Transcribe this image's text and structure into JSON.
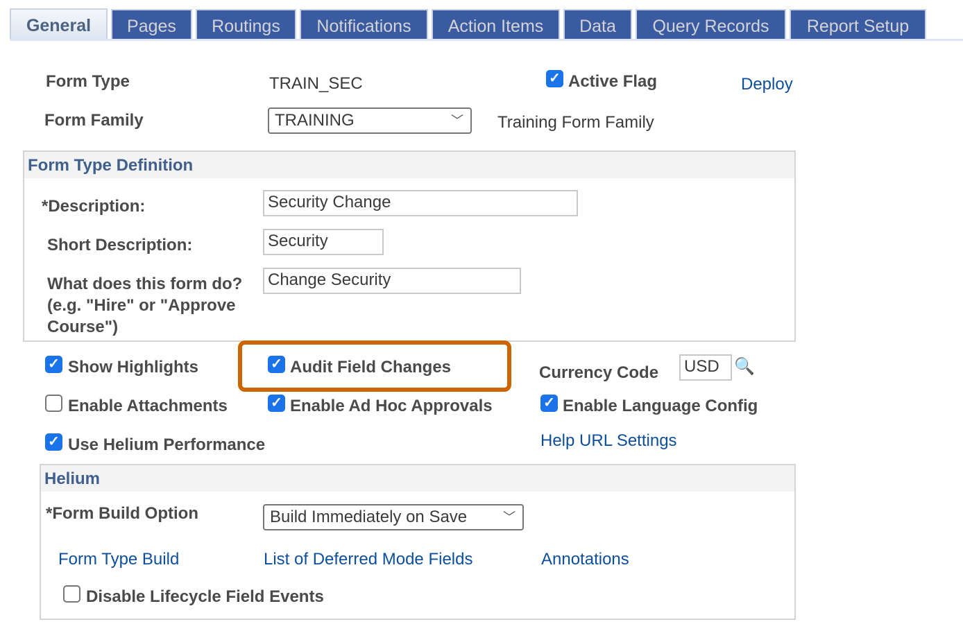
{
  "tabs": [
    {
      "label": "General",
      "active": true
    },
    {
      "label": "Pages"
    },
    {
      "label": "Routings"
    },
    {
      "label": "Notifications"
    },
    {
      "label": "Action Items"
    },
    {
      "label": "Data"
    },
    {
      "label": "Query Records"
    },
    {
      "label": "Report Setup"
    }
  ],
  "header": {
    "form_type_label": "Form Type",
    "form_type_value": "TRAIN_SEC",
    "active_flag_label": "Active Flag",
    "active_flag_checked": true,
    "deploy_link": "Deploy",
    "form_family_label": "Form Family",
    "form_family_value": "TRAINING",
    "form_family_desc": "Training Form Family"
  },
  "definition": {
    "title": "Form Type Definition",
    "description_label": "*Description:",
    "description_value": "Security Change",
    "short_label": "Short Description:",
    "short_value": "Security",
    "what_label_1": "What does this form do?",
    "what_label_2": "(e.g. \"Hire\" or \"Approve",
    "what_label_3": "Course\")",
    "what_value": "Change Security"
  },
  "options": {
    "show_highlights": "Show Highlights",
    "audit_field_changes": "Audit Field Changes",
    "currency_label": "Currency Code",
    "currency_value": "USD",
    "enable_attachments": "Enable Attachments",
    "enable_adhoc": "Enable Ad Hoc Approvals",
    "enable_language": "Enable Language Config",
    "use_helium": "Use Helium Performance",
    "help_url": "Help URL Settings"
  },
  "helium": {
    "title": "Helium",
    "build_label": "*Form Build Option",
    "build_value": "Build Immediately on Save",
    "form_type_build": "Form Type Build",
    "deferred_fields": "List of Deferred Mode Fields",
    "annotations": "Annotations",
    "disable_lifecycle": "Disable Lifecycle Field Events"
  },
  "colors": {
    "tab_bg": "#3a5ba2",
    "link": "#0d4f9c",
    "highlight": "#cc6600",
    "checkbox": "#1a73e8"
  }
}
